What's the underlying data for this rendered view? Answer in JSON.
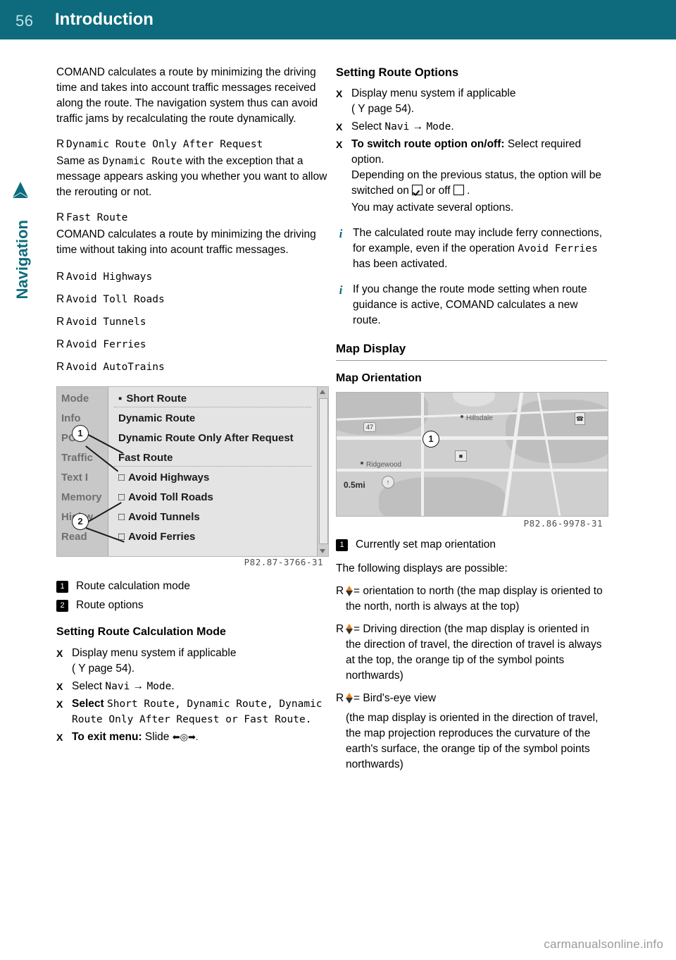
{
  "header": {
    "page_number": "56",
    "chapter": "Introduction"
  },
  "side_tab": {
    "label": "Navigation"
  },
  "left_column": {
    "intro_paragraph": "COMAND calculates a route by minimizing the driving time and takes into account traffic messages received along the route. The navigation system thus can avoid traffic jams by recalculating the route dynamically.",
    "options": [
      {
        "title": "Dynamic Route Only After Request",
        "body_prefix": "Same as ",
        "body_mono": "Dynamic Route",
        "body_suffix": " with the exception that a message appears asking you whether you want to allow the rerouting or not."
      },
      {
        "title": "Fast Route",
        "body": "COMAND calculates a route by minimizing the driving time without taking into acount traffic messages."
      }
    ],
    "simple_options": [
      "Avoid Highways",
      "Avoid Toll Roads",
      "Avoid Tunnels",
      "Avoid Ferries",
      "Avoid AutoTrains"
    ],
    "screenshot": {
      "left_menu": [
        "Mode",
        "Info",
        "POI",
        "Traffic",
        "Text I",
        "Memory",
        "Highw",
        "Read"
      ],
      "list_items": [
        "Short Route",
        "Dynamic Route",
        "Dynamic Route Only After Request",
        "Fast Route"
      ],
      "checkbox_items": [
        "Avoid Highways",
        "Avoid Toll Roads",
        "Avoid Tunnels",
        "Avoid Ferries"
      ],
      "callouts": [
        "1",
        "2"
      ],
      "photo_code": "P82.87-3766-31"
    },
    "legend": [
      {
        "num": "1",
        "text": "Route calculation mode"
      },
      {
        "num": "2",
        "text": "Route options"
      }
    ],
    "section_heading": "Setting Route Calculation Mode",
    "steps": [
      {
        "text": "Display menu system if applicable",
        "sub": "( Y page 54)."
      },
      {
        "text_pre": "Select ",
        "mono": "Navi",
        "arrow": " → ",
        "mono2": "Mode",
        "text_post": "."
      },
      {
        "bold": "Select ",
        "mono_list": "Short Route, Dynamic Route, Dynamic Route Only After Request or Fast Route."
      },
      {
        "bold_label": "To exit menu:",
        "text": " Slide "
      }
    ]
  },
  "right_column": {
    "heading_route_options": "Setting Route Options",
    "steps": [
      {
        "text": "Display menu system if applicable",
        "sub": "( Y page 54)."
      },
      {
        "text_pre": "Select ",
        "mono": "Navi",
        "arrow": " → ",
        "mono2": "Mode",
        "text_post": "."
      },
      {
        "bold_label": "To switch route option on/off:",
        "text": " Select required option.",
        "line2": "Depending on the previous status, the option will be switched on",
        "line2_mid": "or off",
        "line3": "You may activate several options."
      }
    ],
    "notes": [
      {
        "pre": "The calculated route may include ferry connections, for example, even if the operation ",
        "mono": "Avoid Ferries",
        "post": " has been activated."
      },
      {
        "pre": "If you change the route mode setting when route guidance is active, COMAND calculates a new route."
      }
    ],
    "heading_map_display": "Map Display",
    "heading_map_orientation": "Map Orientation",
    "map": {
      "scale_label": "0.5mi",
      "labels": [
        "Hillsdale",
        "Ridgewood"
      ],
      "photo_code": "P82.86-9978-31",
      "callout": "1"
    },
    "legend": [
      {
        "num": "1",
        "text": "Currently set map orientation"
      }
    ],
    "following_line": "The following displays are possible:",
    "orientation_items": [
      "= orientation to north (the map display is oriented to the north, north is always at the top)",
      "= Driving direction (the map display is oriented in the direction of travel, the direction of travel is always at the top, the orange tip of the symbol points northwards)",
      "= Bird's-eye view",
      "(the map display is oriented in the direction of travel, the map projection reproduces the curvature of the earth's surface, the orange tip of the symbol points northwards)"
    ]
  },
  "footer": {
    "watermark": "carmanualsonline.info"
  },
  "colors": {
    "header_teal": "#0d6b7d",
    "orange": "#e8821e"
  }
}
